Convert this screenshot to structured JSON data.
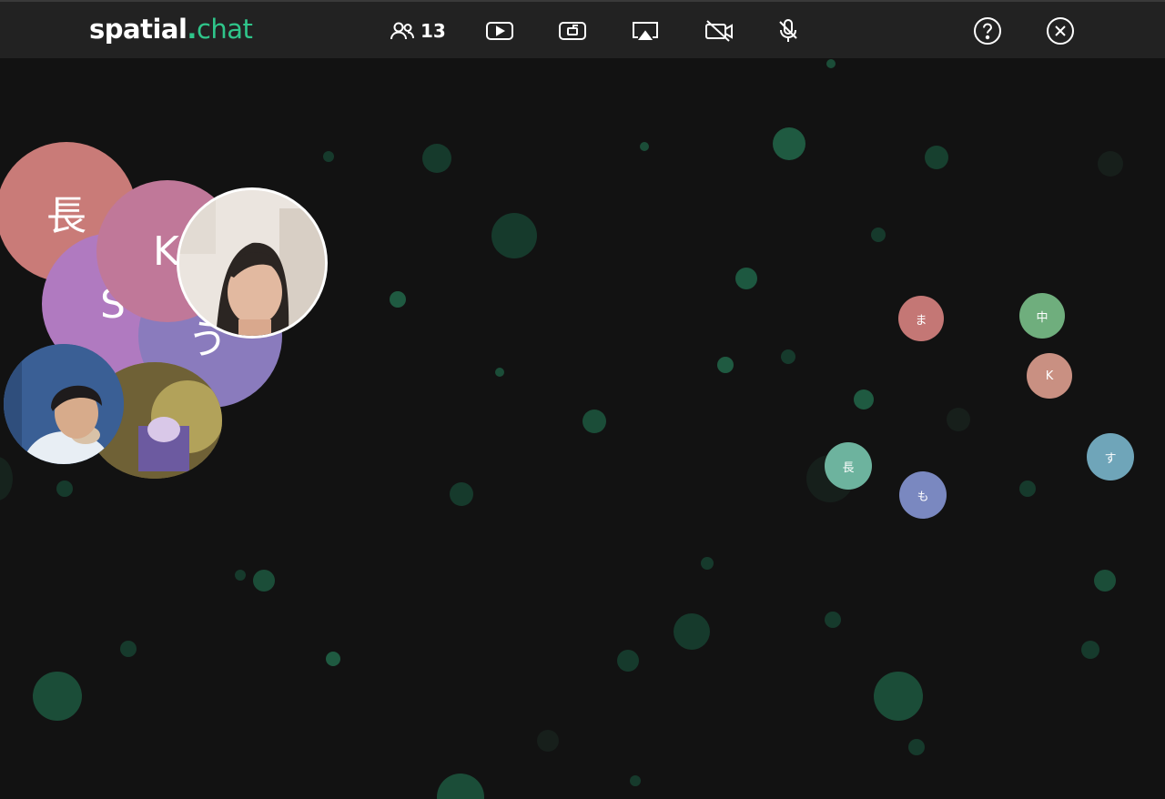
{
  "app": {
    "logo_main": "spatial",
    "logo_dot": ".",
    "logo_sub": "chat",
    "brand_color": "#2fc58a"
  },
  "toolbar": {
    "participants_count": "13",
    "icons": [
      "users-icon",
      "play-icon",
      "share-screen-icon",
      "airplay-icon",
      "camera-off-icon",
      "mic-off-icon",
      "help-icon",
      "close-icon"
    ]
  },
  "room": {
    "cluster": [
      {
        "label": "長",
        "color": "#c97b78"
      },
      {
        "label": "S",
        "color": "#b07ac0"
      },
      {
        "label": "K",
        "color": "#c07899"
      },
      {
        "label": "う",
        "color": "#8a7bbd"
      }
    ],
    "others": [
      {
        "label": "ま",
        "color": "#c47775"
      },
      {
        "label": "中",
        "color": "#6fae7d"
      },
      {
        "label": "K",
        "color": "#c99082"
      },
      {
        "label": "長",
        "color": "#6db39e"
      },
      {
        "label": "も",
        "color": "#7a88c0"
      },
      {
        "label": "す",
        "color": "#6fa5b9"
      }
    ]
  }
}
